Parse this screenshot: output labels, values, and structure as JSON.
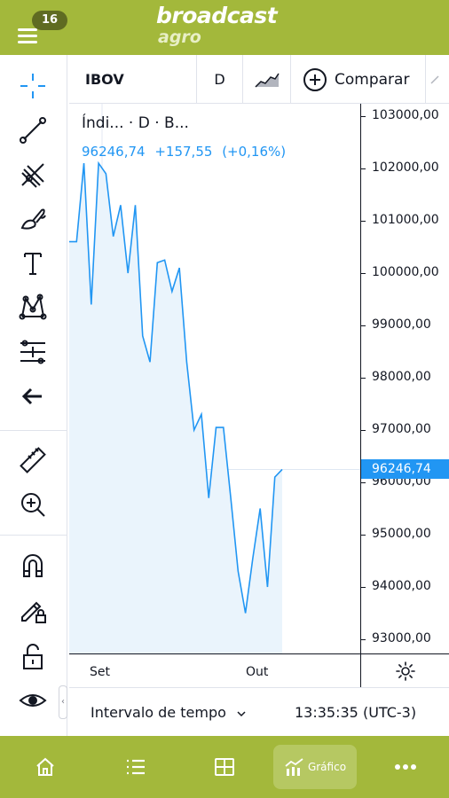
{
  "header": {
    "notification_count": "16",
    "brand_name": "broadcast",
    "brand_suffix": "agro"
  },
  "left_toolbar": {
    "tools": [
      "crosshair-icon",
      "trend-line-icon",
      "pitchfork-icon",
      "brush-icon",
      "text-icon",
      "pattern-icon",
      "fib-retracement-icon",
      "arrow-left-icon",
      "ruler-icon",
      "zoom-in-icon",
      "magnet-icon",
      "lock-drawing-icon",
      "unlock-icon",
      "eye-icon"
    ]
  },
  "top_toolbar": {
    "symbol": "IBOV",
    "interval": "D",
    "compare_label": "Comparar"
  },
  "legend": {
    "title": "Índi... · D · B...",
    "last": "96246,74",
    "change": "+157,55",
    "change_pct": "(+0,16%)"
  },
  "colors": {
    "header_bg": "#a3b83b",
    "line": "#2196f3",
    "area_fill": "#eaf4fc",
    "last_price_bg": "#2196f3"
  },
  "price_scale": {
    "ticks": [
      "103000,00",
      "102000,00",
      "101000,00",
      "100000,00",
      "99000,00",
      "98000,00",
      "97000,00",
      "96000,00",
      "95000,00",
      "94000,00",
      "93000,00"
    ],
    "last_price_label": "96246,74"
  },
  "time_scale": {
    "labels": [
      "Set",
      "Out"
    ]
  },
  "bottom_toolbar": {
    "interval_label": "Intervalo de tempo",
    "clock": "13:35:35 (UTC-3)"
  },
  "bottom_nav": {
    "items": [
      "home-icon",
      "list-icon",
      "grid-icon",
      "chart-icon",
      "more-icon"
    ],
    "active_label": "Gráfico"
  },
  "chart_data": {
    "type": "area",
    "ylim": [
      92800,
      103200
    ],
    "y_ticks": [
      103000,
      102000,
      101000,
      100000,
      99000,
      98000,
      97000,
      96000,
      95000,
      94000,
      93000
    ],
    "x_labels": [
      "Set",
      "Out"
    ],
    "last_value": 96246.74,
    "values": [
      100600,
      100600,
      102100,
      99400,
      102100,
      101900,
      100700,
      101300,
      100000,
      101300,
      98800,
      98300,
      100200,
      100250,
      99650,
      100100,
      98300,
      97000,
      97300,
      95700,
      97050,
      97050,
      95700,
      94300,
      93500,
      94550,
      95500,
      94000,
      96100,
      96246.74
    ]
  }
}
